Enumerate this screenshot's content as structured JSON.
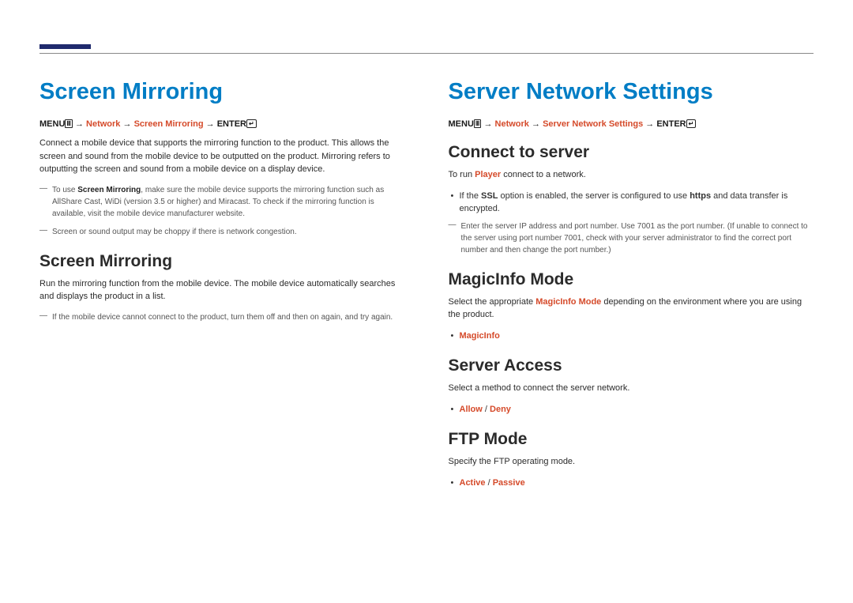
{
  "left": {
    "title": "Screen Mirroring",
    "breadcrumb": {
      "menu": "MENU",
      "path1": "Network",
      "path2": "Screen Mirroring",
      "enter": "ENTER"
    },
    "intro": "Connect a mobile device that supports the mirroring function to the product. This allows the screen and sound from the mobile device to be outputted on the product. Mirroring refers to outputting the screen and sound from a mobile device on a display device.",
    "note1_pre": "To use ",
    "note1_bold": "Screen Mirroring",
    "note1_post": ", make sure the mobile device supports the mirroring function such as AllShare Cast, WiDi (version 3.5 or higher) and Miracast. To check if the mirroring function is available, visit the mobile device manufacturer website.",
    "note2": "Screen or sound output may be choppy if there is network congestion.",
    "sub_heading": "Screen Mirroring",
    "sub_body": "Run the mirroring function from the mobile device. The mobile device automatically searches and displays the product in a list.",
    "sub_note": "If the mobile device cannot connect to the product, turn them off and then on again, and try again."
  },
  "right": {
    "title": "Server Network Settings",
    "breadcrumb": {
      "menu": "MENU",
      "path1": "Network",
      "path2": "Server Network Settings",
      "enter": "ENTER"
    },
    "connect": {
      "heading": "Connect to server",
      "body_pre": "To run ",
      "body_bold": "Player",
      "body_post": " connect to a network.",
      "bullet_pre": "If the ",
      "bullet_bold": "SSL",
      "bullet_post": " option is enabled, the server is configured to use ",
      "bullet_bold2": "https",
      "bullet_post2": " and data transfer is encrypted.",
      "note": "Enter the server IP address and port number. Use 7001 as the port number. (If unable to connect to the server using port number 7001, check with your server administrator to find the correct port number and then change the port number.)"
    },
    "magic": {
      "heading": "MagicInfo Mode",
      "body_pre": "Select the appropriate ",
      "body_bold": "MagicInfo Mode",
      "body_post": " depending on the environment where you are using the product.",
      "opt": "MagicInfo"
    },
    "access": {
      "heading": "Server Access",
      "body": "Select a method to connect the server network.",
      "opt1": "Allow",
      "opt2": "Deny"
    },
    "ftp": {
      "heading": "FTP Mode",
      "body": "Specify the FTP operating mode.",
      "opt1": "Active",
      "opt2": "Passive"
    }
  }
}
